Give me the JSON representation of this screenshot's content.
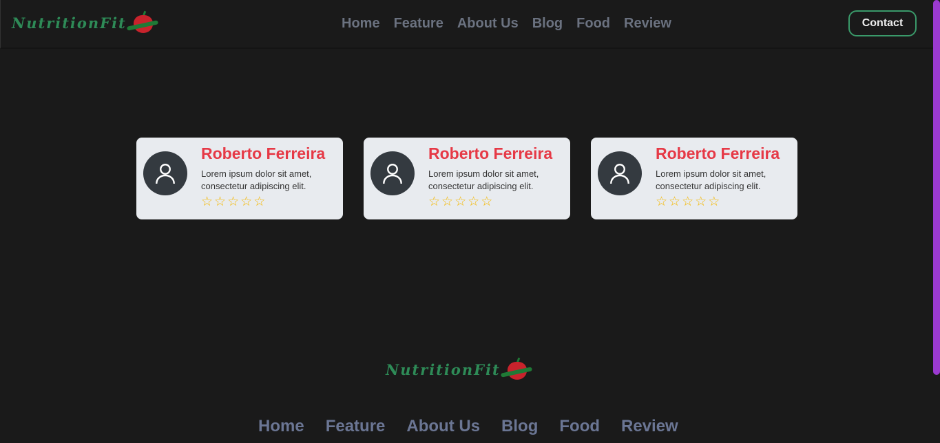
{
  "brand": {
    "name": "NutritionFit"
  },
  "nav": {
    "items": [
      "Home",
      "Feature",
      "About Us",
      "Blog",
      "Food",
      "Review"
    ],
    "contact_label": "Contact"
  },
  "reviews": [
    {
      "name": "Roberto Ferreira",
      "text": "Lorem ipsum dolor sit amet, consectetur adipiscing elit.",
      "rating": 0,
      "max": 5
    },
    {
      "name": "Roberto Ferreira",
      "text": "Lorem ipsum dolor sit amet, consectetur adipiscing elit.",
      "rating": 0,
      "max": 5
    },
    {
      "name": "Roberto Ferreira",
      "text": "Lorem ipsum dolor sit amet, consectetur adipiscing elit.",
      "rating": 0,
      "max": 5
    }
  ],
  "footer": {
    "brand": "NutritionFit",
    "nav": [
      "Home",
      "Feature",
      "About Us",
      "Blog",
      "Food",
      "Review"
    ]
  },
  "colors": {
    "brand_green": "#2e8b57",
    "accent_red": "#e63946",
    "star": "#f5b800",
    "scrollbar": "#9b3ad0"
  }
}
